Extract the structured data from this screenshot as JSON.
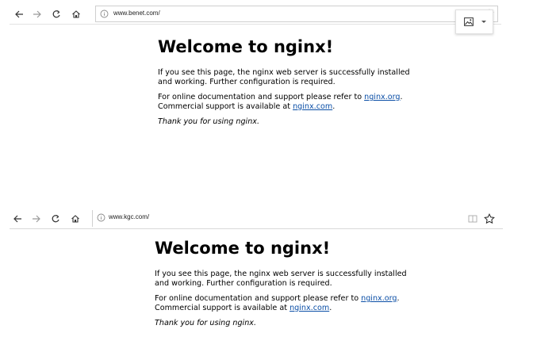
{
  "windows": [
    {
      "url": "www.benet.com/",
      "heading": "Welcome to nginx!",
      "para1": "If you see this page, the nginx web server is successfully installed and working. Further configuration is required.",
      "para2_prefix": "For online documentation and support please refer to ",
      "doc_link": "nginx.org",
      "para2_mid": ".",
      "para2_line2_prefix": "Commercial support is available at ",
      "support_link": "nginx.com",
      "para2_suffix": ".",
      "thanks": "Thank you for using nginx."
    },
    {
      "url": "www.kgc.com/",
      "heading": "Welcome to nginx!",
      "para1": "If you see this page, the nginx web server is successfully installed and working. Further configuration is required.",
      "para2_prefix": "For online documentation and support please refer to ",
      "doc_link": "nginx.org",
      "para2_mid": ".",
      "para2_line2_prefix": "Commercial support is available at ",
      "support_link": "nginx.com",
      "para2_suffix": ".",
      "thanks": "Thank you for using nginx."
    }
  ],
  "icons": {
    "back": "back-arrow-icon",
    "forward": "forward-arrow-icon",
    "refresh": "refresh-icon",
    "home": "home-icon",
    "site_info": "site-info-icon",
    "favorite": "star-icon",
    "reading_view": "reading-view-icon",
    "image_menu": "image-icon"
  },
  "colors": {
    "link": "#0a4ea6",
    "toolbar_icon": "#333333",
    "disabled_icon": "#9a9a9a"
  }
}
